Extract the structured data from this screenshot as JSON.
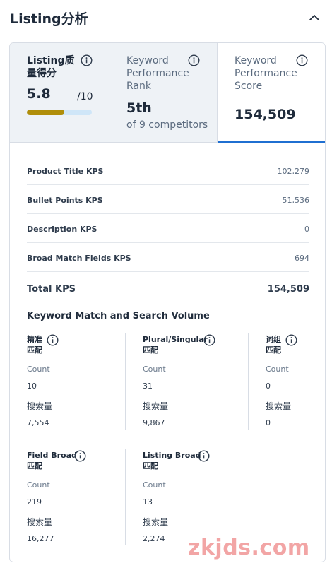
{
  "section": {
    "title": "Listing分析"
  },
  "tabs": {
    "quality": {
      "label_line1": "Listing质",
      "label_line2": "量得分",
      "score": "5.8",
      "denominator": "/10",
      "progress_fraction": 0.58
    },
    "rank": {
      "label_line1": "Keyword",
      "label_line2": "Performance",
      "label_line3": "Rank",
      "value": "5th",
      "sub": "of 9 competitors"
    },
    "kps": {
      "label_line1": "Keyword",
      "label_line2": "Performance",
      "label_line3": "Score",
      "value": "154,509"
    }
  },
  "kps_breakdown": {
    "rows": [
      {
        "label": "Product Title KPS",
        "value": "102,279"
      },
      {
        "label": "Bullet Points KPS",
        "value": "51,536"
      },
      {
        "label": "Description KPS",
        "value": "0"
      },
      {
        "label": "Broad Match Fields KPS",
        "value": "694"
      }
    ],
    "total": {
      "label": "Total KPS",
      "value": "154,509"
    }
  },
  "keyword_match": {
    "title": "Keyword Match and Search Volume",
    "count_label": "Count",
    "volume_label": "搜索量",
    "row1": [
      {
        "name_line1": "精准",
        "name_line2": "匹配",
        "count": "10",
        "volume": "7,554"
      },
      {
        "name_line1": "Plural/Singular",
        "name_line2": "匹配",
        "count": "31",
        "volume": "9,867"
      },
      {
        "name_line1": "词组",
        "name_line2": "匹配",
        "count": "0",
        "volume": "0"
      }
    ],
    "row2": [
      {
        "name_line1": "Field Broad",
        "name_line2": "匹配",
        "count": "219",
        "volume": "16,277"
      },
      {
        "name_line1": "Listing Broad",
        "name_line2": "匹配",
        "count": "13",
        "volume": "2,274"
      }
    ]
  },
  "watermark": "zkjds.com",
  "colors": {
    "accent": "#1f6fd1",
    "progress_fill": "#b08e0a",
    "progress_track": "#cfe6f8"
  }
}
